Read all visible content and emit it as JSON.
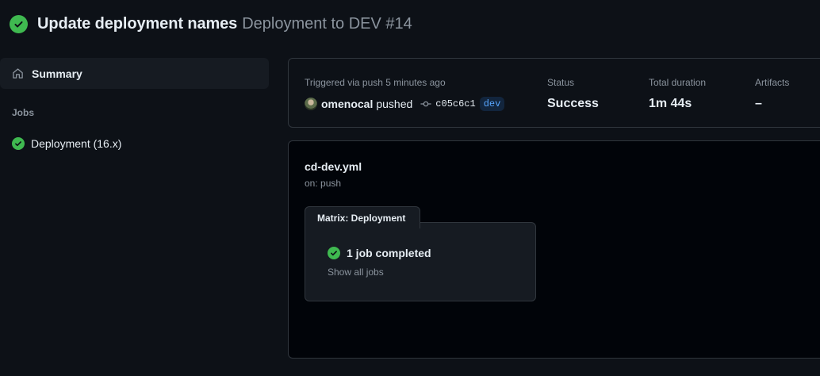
{
  "header": {
    "title": "Update deployment names",
    "subtitle": "Deployment to DEV #14",
    "status_icon": "check-circle-icon"
  },
  "sidebar": {
    "summary_label": "Summary",
    "jobs_heading": "Jobs",
    "jobs": [
      {
        "label": "Deployment (16.x)",
        "status": "success"
      }
    ]
  },
  "run_info": {
    "trigger_label": "Triggered via push 5 minutes ago",
    "user": "omenocal",
    "action": "pushed",
    "commit_sha": "c05c6c1",
    "branch": "dev",
    "status_label": "Status",
    "status_value": "Success",
    "duration_label": "Total duration",
    "duration_value": "1m 44s",
    "artifacts_label": "Artifacts",
    "artifacts_value": "–"
  },
  "workflow": {
    "file": "cd-dev.yml",
    "on": "on: push",
    "matrix_title": "Matrix: Deployment",
    "completed": "1 job completed",
    "show_all": "Show all jobs"
  },
  "colors": {
    "background": "#0d1117",
    "success": "#3fb950",
    "branch": "#58a6ff"
  }
}
